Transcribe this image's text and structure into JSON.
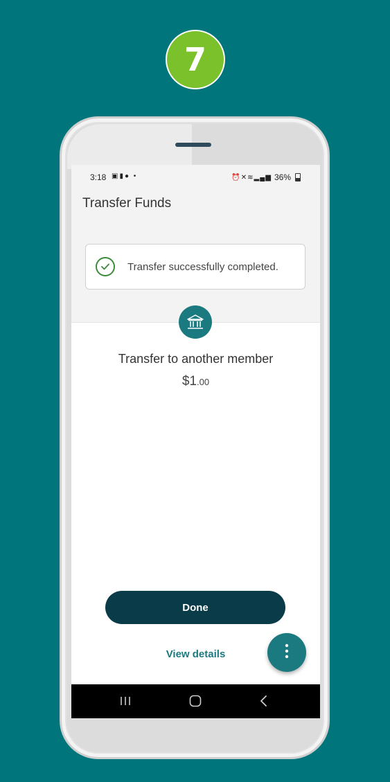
{
  "step": {
    "number": "7"
  },
  "status_bar": {
    "time": "3:18",
    "left_icons": [
      "image-icon",
      "chat-icon",
      "messenger-icon",
      "dot-icon"
    ],
    "right_icons": [
      "alarm-icon",
      "mute-icon",
      "wifi-icon",
      "signal-icon"
    ],
    "battery": "36%"
  },
  "app": {
    "title": "Transfer Funds"
  },
  "toast": {
    "message": "Transfer successfully completed."
  },
  "transfer": {
    "title": "Transfer to another member",
    "amount_dollars": "$1",
    "amount_cents": ".00"
  },
  "actions": {
    "done_label": "Done",
    "view_details_label": "View details"
  },
  "colors": {
    "background": "#00757c",
    "step_badge": "#7ac12b",
    "primary": "#093b48",
    "accent": "#1a7a80",
    "success": "#3d8b3d"
  }
}
